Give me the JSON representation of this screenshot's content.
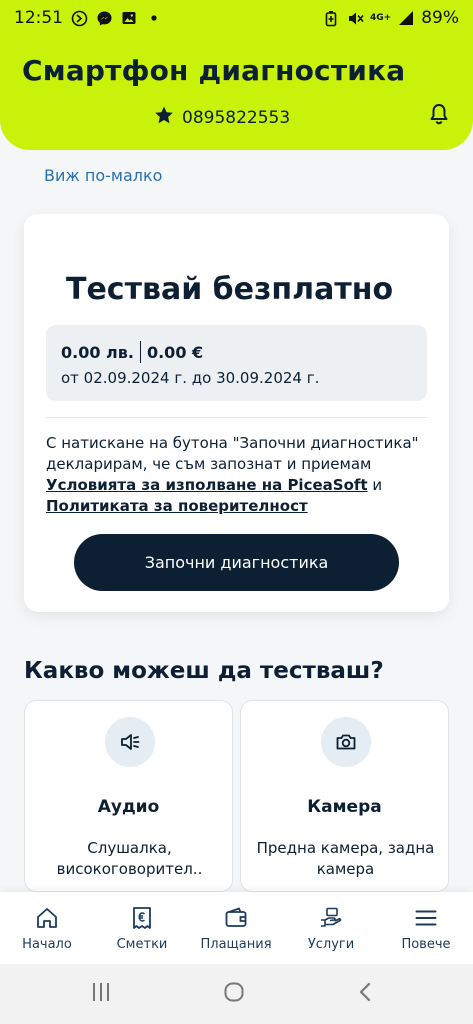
{
  "status_bar": {
    "time": "12:51",
    "network": "4G+",
    "battery": "89%",
    "left_icons": [
      "blocked-call-icon",
      "messenger-icon",
      "gallery-icon",
      "dot-icon"
    ],
    "right_icons": [
      "battery-saver-icon",
      "mute-icon",
      "signal-icon"
    ]
  },
  "header": {
    "title": "Смартфон диагностика",
    "phone": "0895822553",
    "background_color": "#c8f20a"
  },
  "see_less": "Виж по-малко",
  "card": {
    "title": "Тествай безплатно",
    "price_bgn": "0.00 лв.",
    "price_eur": "0.00 €",
    "period": "от 02.09.2024 г. до 30.09.2024 г.",
    "terms_prefix": "С натискане на бутона \"Започни диагностика\" декларирам, че съм запознат и приемам",
    "terms_link": " Условията за изполване на PiceaSoft",
    "terms_and": " и ",
    "privacy_link": "Политиката за поверителност",
    "button": "Започни диагностика"
  },
  "features": {
    "title": "Какво можеш да тестваш?",
    "items": [
      {
        "name": "Аудио",
        "description": "Слушалка, високоговорител..",
        "icon": "speaker-icon"
      },
      {
        "name": "Камера",
        "description": "Предна камера, задна камера",
        "icon": "camera-icon"
      }
    ]
  },
  "bottom_nav": {
    "items": [
      {
        "label": "Начало",
        "icon": "home-icon"
      },
      {
        "label": "Сметки",
        "icon": "bill-icon"
      },
      {
        "label": "Плащания",
        "icon": "wallet-icon"
      },
      {
        "label": "Услуги",
        "icon": "services-icon"
      },
      {
        "label": "Повече",
        "icon": "menu-icon"
      }
    ]
  },
  "colors": {
    "accent": "#c8f20a",
    "primary": "#0d1f33",
    "link": "#2a6fb0"
  }
}
